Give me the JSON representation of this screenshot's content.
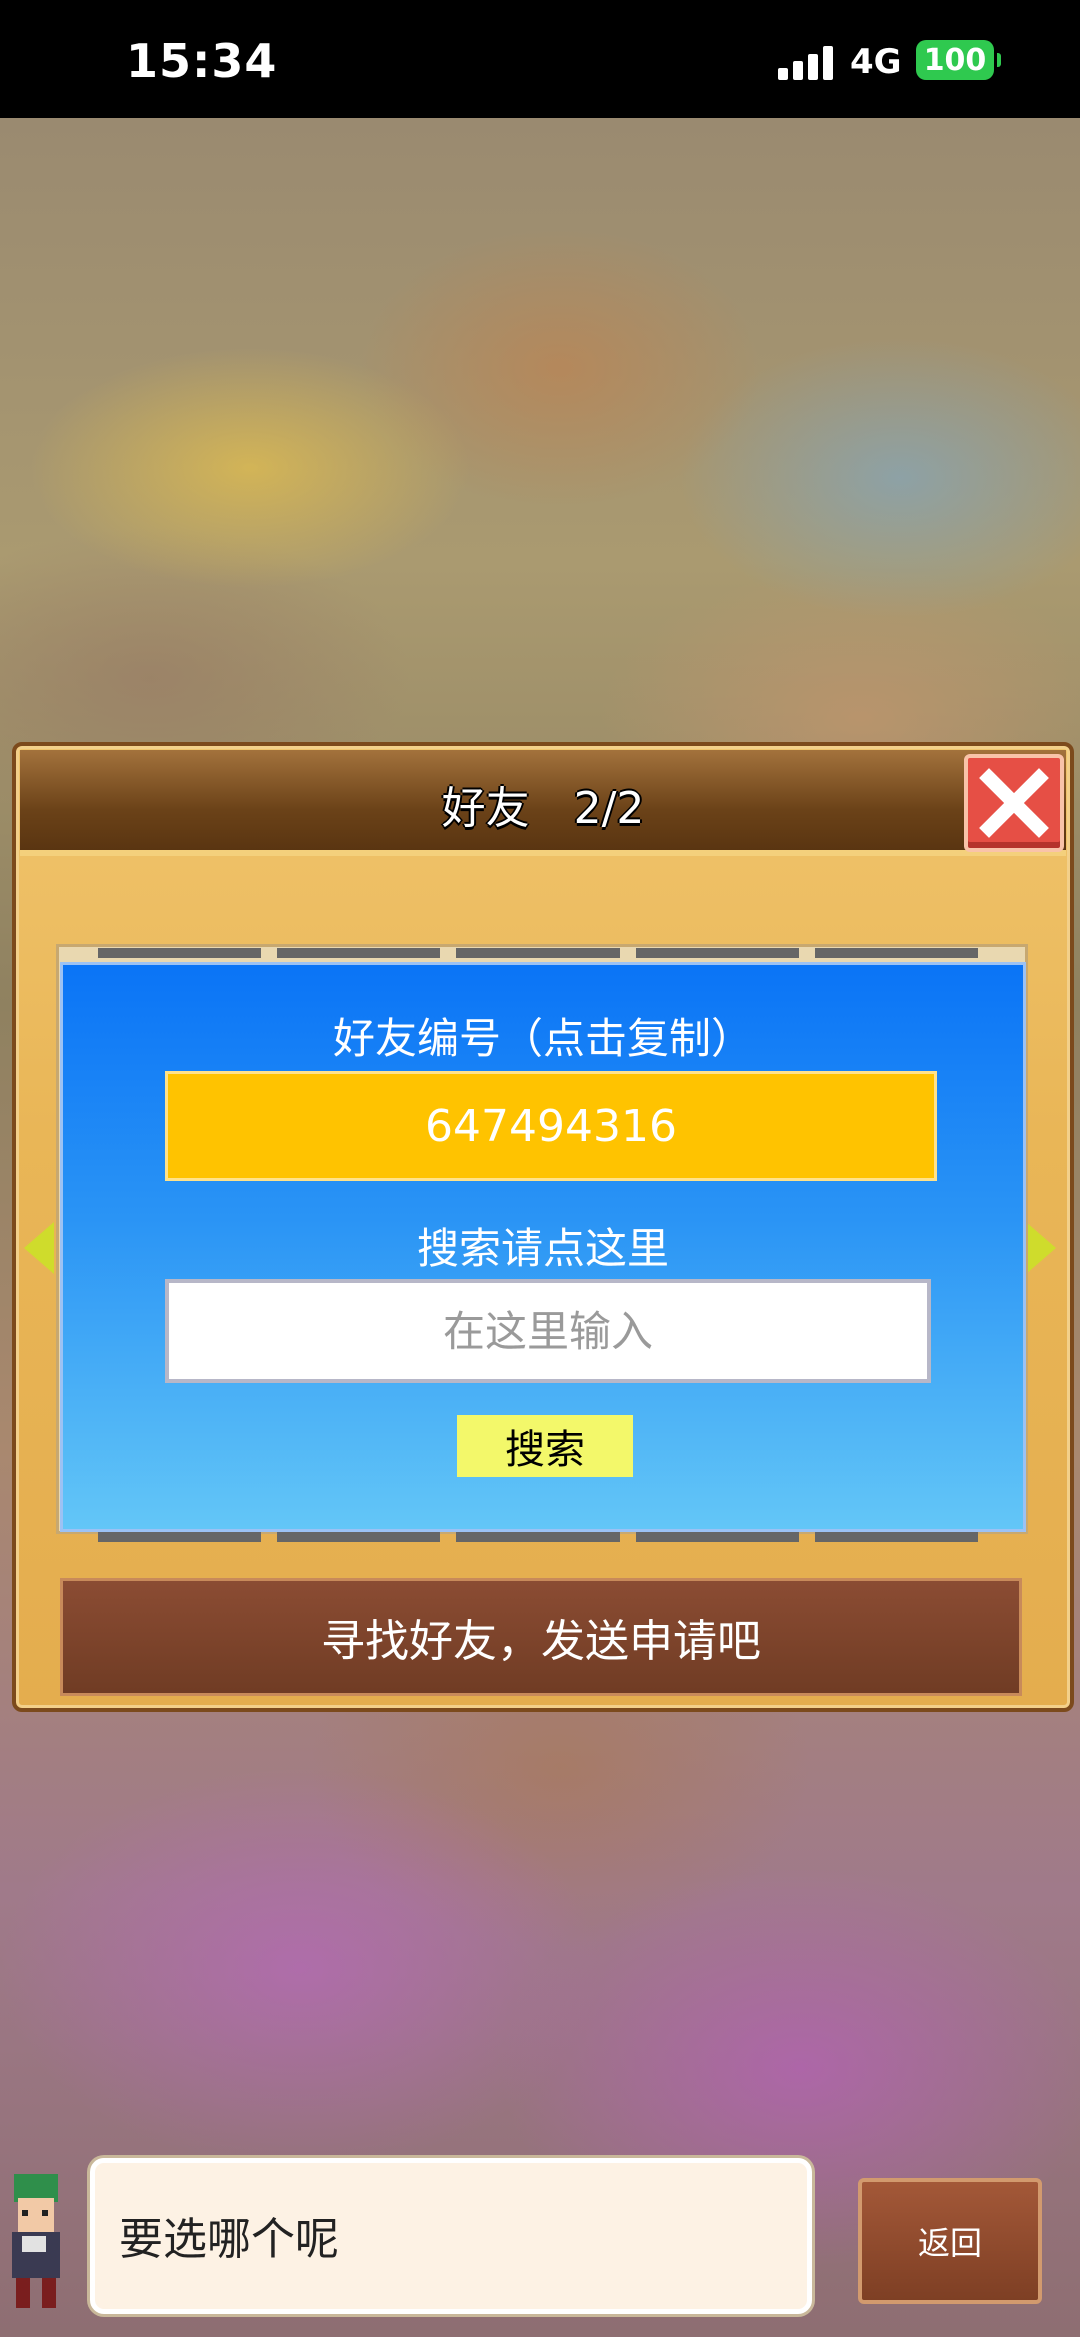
{
  "status_bar": {
    "time": "15:34",
    "network": "4G",
    "battery": "100"
  },
  "dialog": {
    "title": "好友　2/2",
    "friend_id_label": "好友编号（点击复制）",
    "friend_id": "647494316",
    "search_label": "搜索请点这里",
    "search_placeholder": "在这里输入",
    "search_button": "搜索",
    "find_friends_button": "寻找好友，发送申请吧"
  },
  "bottom": {
    "speech": "要选哪个呢",
    "back_button": "返回"
  },
  "colors": {
    "panel_blue": "#1a84f5",
    "id_box": "#ffc300",
    "close_red": "#e64f45",
    "battery_green": "#2fc94f"
  },
  "icons": {
    "close": "close-icon",
    "prev": "arrow-left-icon",
    "next": "arrow-right-icon"
  }
}
